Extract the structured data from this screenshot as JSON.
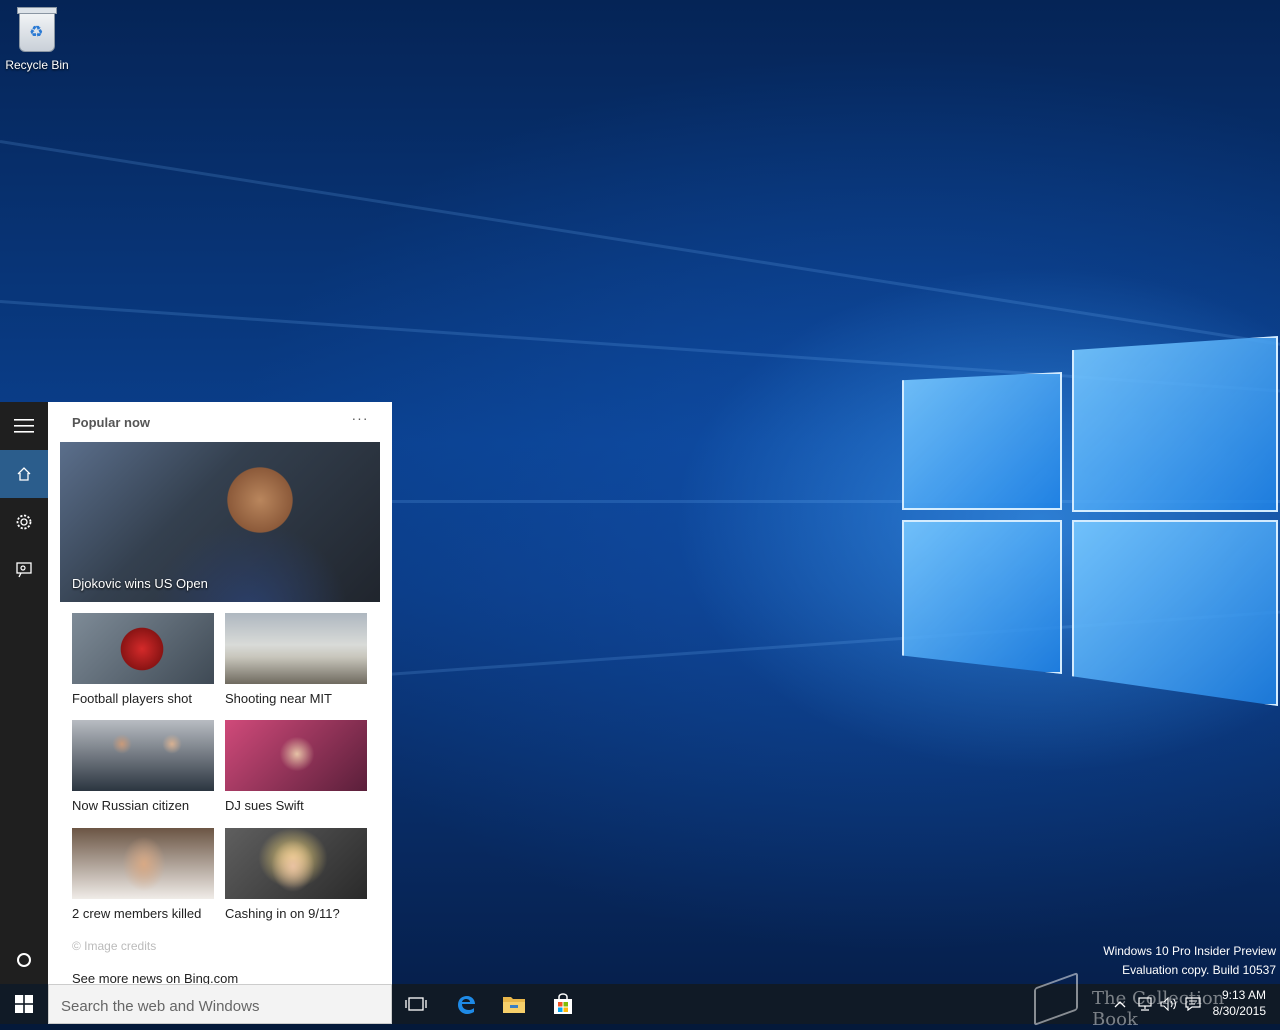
{
  "desktop": {
    "icons": [
      {
        "label": "Recycle Bin",
        "icon": "recycle-bin-icon"
      }
    ],
    "watermark": {
      "line1": "Windows 10 Pro Insider Preview",
      "line2": "Evaluation copy. Build 10537"
    },
    "overlay_brand": "The Collection Book"
  },
  "cortana": {
    "rail": [
      {
        "name": "hamburger-menu",
        "icon": "menu-icon"
      },
      {
        "name": "home",
        "icon": "home-icon",
        "active": true
      },
      {
        "name": "settings",
        "icon": "gear-icon"
      },
      {
        "name": "feedback",
        "icon": "feedback-icon"
      }
    ],
    "title": "Popular now",
    "more_label": "···",
    "hero": {
      "caption": "Djokovic wins US Open"
    },
    "tiles": [
      {
        "caption": "Football players shot"
      },
      {
        "caption": "Shooting near MIT"
      },
      {
        "caption": "Now Russian citizen"
      },
      {
        "caption": "DJ sues Swift"
      },
      {
        "caption": "2 crew members killed"
      },
      {
        "caption": "Cashing in on 9/11?"
      }
    ],
    "credits": "© Image credits",
    "see_more": "See more news on Bing.com"
  },
  "taskbar": {
    "search_placeholder": "Search the web and Windows",
    "pinned": [
      "task-view-icon",
      "edge-icon",
      "file-explorer-icon",
      "store-icon"
    ],
    "tray": [
      "chevron-up-icon",
      "network-icon",
      "volume-icon",
      "action-center-icon"
    ],
    "time": "9:13 AM",
    "date": "8/30/2015"
  }
}
